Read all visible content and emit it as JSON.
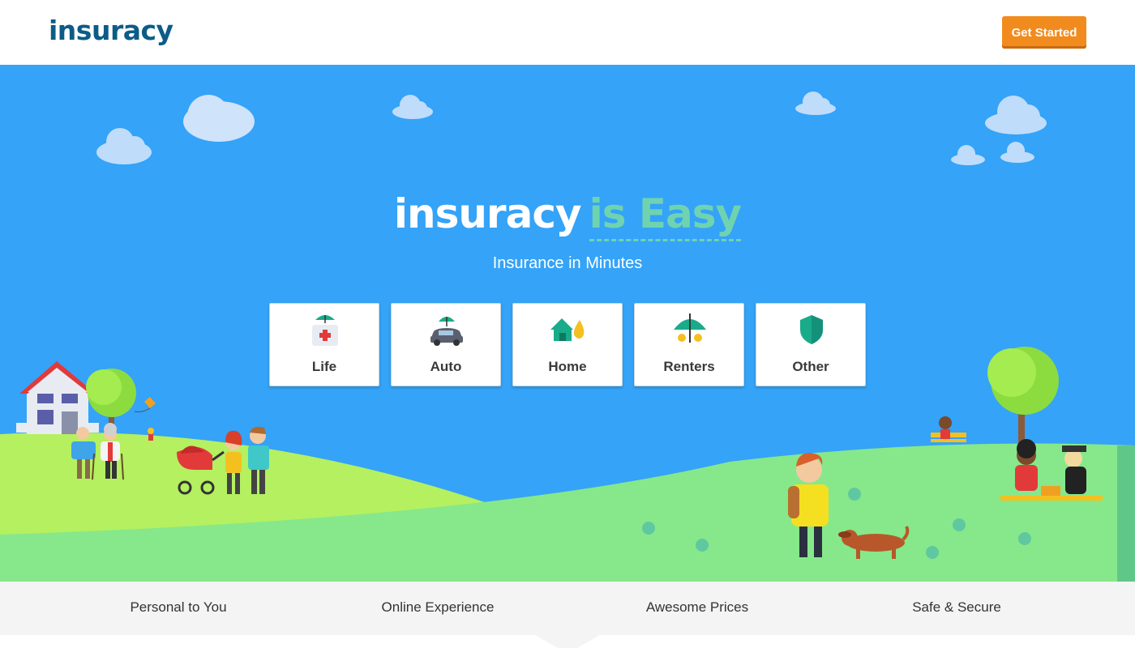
{
  "header": {
    "logo": "insuracy",
    "cta_label": "Get Started"
  },
  "hero": {
    "brand": "insuracy",
    "rotating_text": "is Easy",
    "subtitle": "Insurance in Minutes",
    "cards": [
      {
        "label": "Life",
        "icon": "umbrella-first-aid-icon"
      },
      {
        "label": "Auto",
        "icon": "umbrella-car-icon"
      },
      {
        "label": "Home",
        "icon": "house-water-drop-icon"
      },
      {
        "label": "Renters",
        "icon": "umbrella-coins-icon"
      },
      {
        "label": "Other",
        "icon": "shield-icon"
      }
    ]
  },
  "features": [
    "Personal to You",
    "Online Experience",
    "Awesome Prices",
    "Safe & Secure"
  ],
  "colors": {
    "brand": "#0c5c87",
    "cta": "#f28b1e",
    "sky": "#34a3f8",
    "accent": "#6fd3b0",
    "hill_light": "#b4f060",
    "hill_green": "#86e88a"
  }
}
